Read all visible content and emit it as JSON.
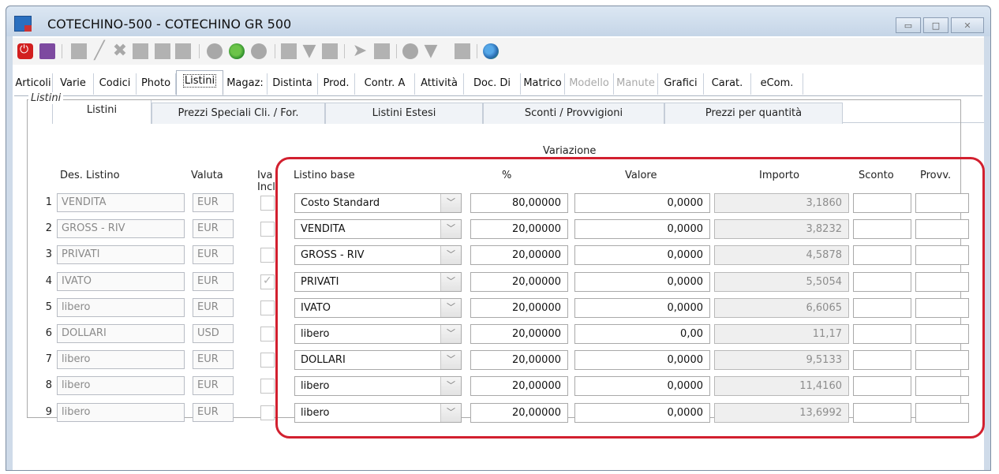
{
  "window": {
    "title": "COTECHINO-500 - COTECHINO GR 500",
    "controls": {
      "minimize": "▭",
      "maximize": "□",
      "close": "✕"
    }
  },
  "tabs_main": [
    {
      "label": "Articoli",
      "state": "normal"
    },
    {
      "label": "Varie",
      "state": "normal"
    },
    {
      "label": "Codici",
      "state": "normal"
    },
    {
      "label": "Photo",
      "state": "normal"
    },
    {
      "label": "Listini",
      "state": "active"
    },
    {
      "label": "Magaz:",
      "state": "normal"
    },
    {
      "label": "Distinta",
      "state": "normal"
    },
    {
      "label": "Prod.",
      "state": "normal"
    },
    {
      "label": "Contr. A",
      "state": "normal"
    },
    {
      "label": "Attività",
      "state": "normal"
    },
    {
      "label": "Doc. Di",
      "state": "normal"
    },
    {
      "label": "Matrico",
      "state": "normal"
    },
    {
      "label": "Modello",
      "state": "disabled"
    },
    {
      "label": "Manute",
      "state": "disabled"
    },
    {
      "label": "Grafici",
      "state": "normal"
    },
    {
      "label": "Carat.",
      "state": "normal"
    },
    {
      "label": "eCom.",
      "state": "normal"
    }
  ],
  "tabs_sub": [
    {
      "label": "Listini",
      "active": true
    },
    {
      "label": "Prezzi Speciali Cli. / For.",
      "active": false
    },
    {
      "label": "Listini Estesi",
      "active": false
    },
    {
      "label": "Sconti / Provvigioni",
      "active": false
    },
    {
      "label": "Prezzi per quantità",
      "active": false
    }
  ],
  "group_title": "Listini",
  "headers": {
    "variazione": "Variazione",
    "des_listino": "Des. Listino",
    "valuta": "Valuta",
    "iva_incl": "Iva Incl.",
    "listino_base": "Listino base",
    "percent": "%",
    "valore": "Valore",
    "importo": "Importo",
    "sconto": "Sconto",
    "provv": "Provv."
  },
  "rows": [
    {
      "n": "1",
      "des": "VENDITA",
      "valuta": "EUR",
      "iva": false,
      "base": "Costo Standard",
      "pct": "80,00000",
      "valore": "0,0000",
      "importo": "3,1860"
    },
    {
      "n": "2",
      "des": "GROSS - RIV",
      "valuta": "EUR",
      "iva": false,
      "base": "VENDITA",
      "pct": "20,00000",
      "valore": "0,0000",
      "importo": "3,8232"
    },
    {
      "n": "3",
      "des": "PRIVATI",
      "valuta": "EUR",
      "iva": false,
      "base": "GROSS - RIV",
      "pct": "20,00000",
      "valore": "0,0000",
      "importo": "4,5878"
    },
    {
      "n": "4",
      "des": "IVATO",
      "valuta": "EUR",
      "iva": true,
      "base": "PRIVATI",
      "pct": "20,00000",
      "valore": "0,0000",
      "importo": "5,5054"
    },
    {
      "n": "5",
      "des": "libero",
      "valuta": "EUR",
      "iva": false,
      "base": "IVATO",
      "pct": "20,00000",
      "valore": "0,0000",
      "importo": "6,6065"
    },
    {
      "n": "6",
      "des": "DOLLARI",
      "valuta": "USD",
      "iva": false,
      "base": "libero",
      "pct": "20,00000",
      "valore": "0,00",
      "importo": "11,17"
    },
    {
      "n": "7",
      "des": "libero",
      "valuta": "EUR",
      "iva": false,
      "base": "DOLLARI",
      "pct": "20,00000",
      "valore": "0,0000",
      "importo": "9,5133"
    },
    {
      "n": "8",
      "des": "libero",
      "valuta": "EUR",
      "iva": false,
      "base": "libero",
      "pct": "20,00000",
      "valore": "0,0000",
      "importo": "11,4160"
    },
    {
      "n": "9",
      "des": "libero",
      "valuta": "EUR",
      "iva": false,
      "base": "libero",
      "pct": "20,00000",
      "valore": "0,0000",
      "importo": "13,6992"
    }
  ],
  "combo_arrow": "﹀",
  "colors": {
    "highlight": "#d2202f",
    "titlebar": "#cfdbe9"
  }
}
